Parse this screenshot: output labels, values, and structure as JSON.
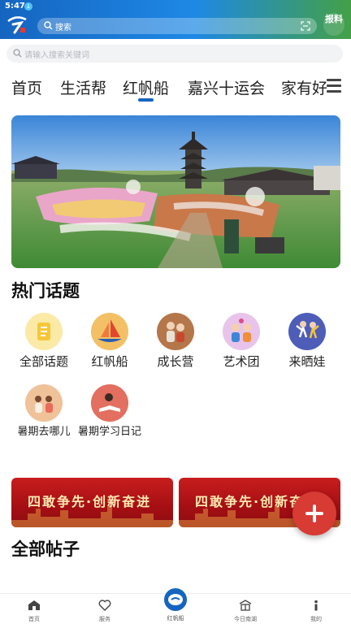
{
  "status": {
    "time": "5:47",
    "indicator": "↓"
  },
  "header": {
    "search_label": "搜索",
    "report_label": "报料"
  },
  "search": {
    "placeholder": "请输入搜索关键词"
  },
  "tabs": [
    {
      "label": "首页"
    },
    {
      "label": "生活帮"
    },
    {
      "label": "红帆船"
    },
    {
      "label": "嘉兴十运会"
    },
    {
      "label": "家有好"
    }
  ],
  "sections": {
    "hot_topics": "热门话题",
    "all_posts": "全部帖子"
  },
  "topics": [
    {
      "label": "全部话题",
      "icon": "document-icon"
    },
    {
      "label": "红帆船",
      "icon": "sailboat-icon"
    },
    {
      "label": "成长营",
      "icon": "growth-camp-icon"
    },
    {
      "label": "艺术团",
      "icon": "art-troupe-icon"
    },
    {
      "label": "来晒娃",
      "icon": "show-baby-icon"
    },
    {
      "label": "暑期去哪儿",
      "icon": "summer-trip-icon"
    },
    {
      "label": "暑期学习日记",
      "icon": "study-diary-icon"
    }
  ],
  "promos": [
    {
      "text": "四敢争先·创新奋进"
    },
    {
      "text": "四敢争先·创新奋进"
    }
  ],
  "bottom_nav": [
    {
      "label": "首页",
      "icon": "home-icon"
    },
    {
      "label": "服务",
      "icon": "heart-icon"
    },
    {
      "label": "红帆船",
      "icon": "sailboat-nav-icon"
    },
    {
      "label": "今日南湖",
      "icon": "building-icon"
    },
    {
      "label": "我的",
      "icon": "info-icon"
    }
  ],
  "colors": {
    "brand_blue": "#1565c0",
    "accent_red": "#d83a34",
    "promo_red": "#b01418"
  }
}
